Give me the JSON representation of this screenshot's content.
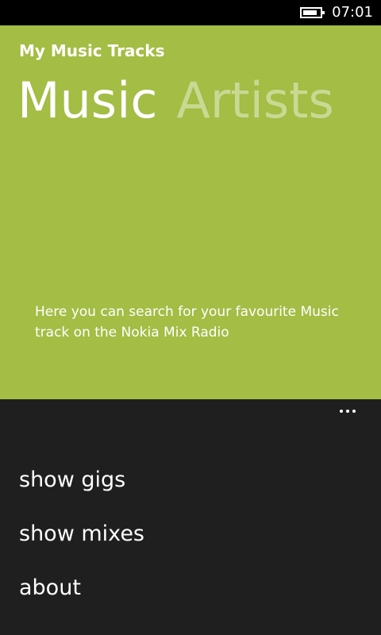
{
  "status_bar": {
    "time": "07:01",
    "battery_icon": "battery-icon"
  },
  "header": {
    "app_title": "My Music Tracks",
    "pivots": [
      {
        "label": "Music"
      },
      {
        "label": "Artists"
      }
    ]
  },
  "content": {
    "intro_text": "Here you can search for your favourite Music track on the Nokia Mix Radio"
  },
  "app_bar": {
    "more_icon": "ellipsis-icon",
    "menu_items": [
      {
        "label": "show gigs"
      },
      {
        "label": "show mixes"
      },
      {
        "label": "about"
      }
    ]
  },
  "colors": {
    "accent": "#a3bd45",
    "app_bar_background": "#1f1f1f",
    "status_bar_background": "#000000",
    "text": "#ffffff"
  }
}
